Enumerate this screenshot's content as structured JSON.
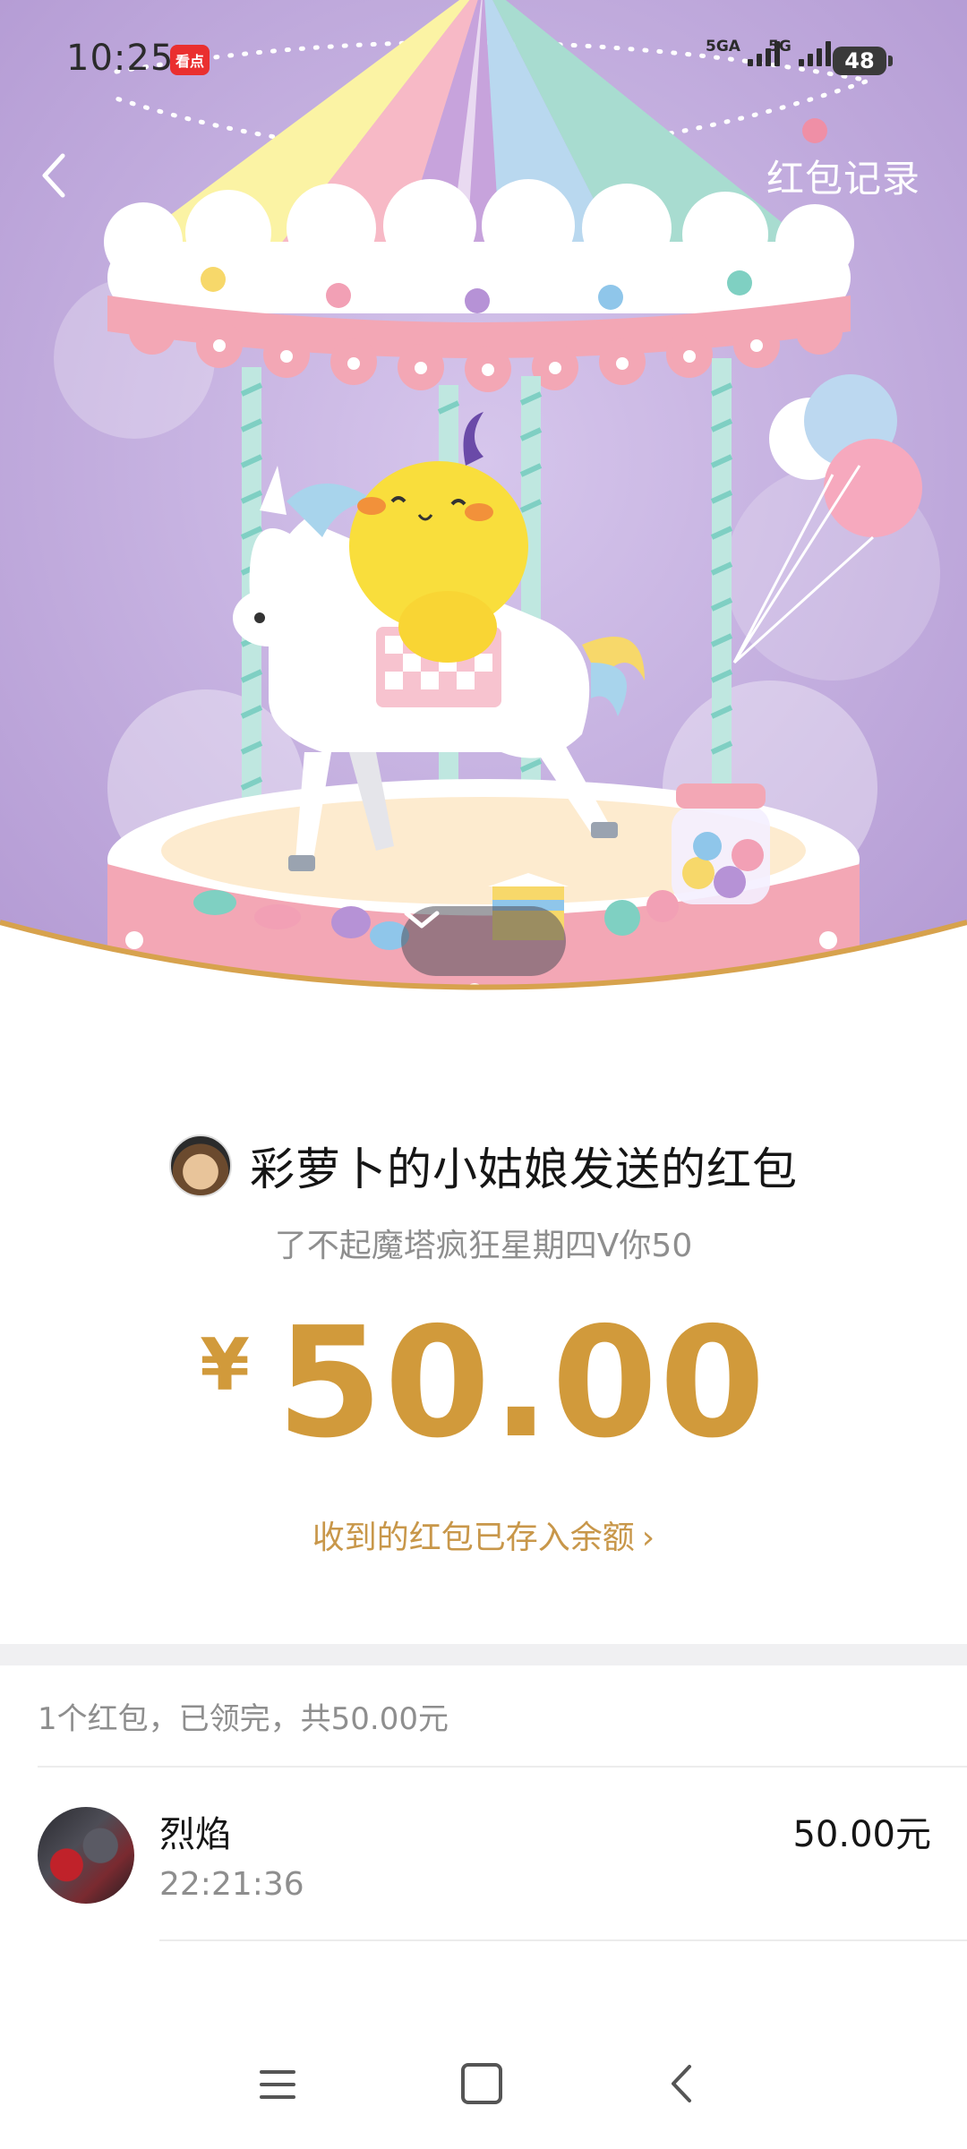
{
  "status_bar": {
    "time": "10:25",
    "news_app_icon": "看点",
    "signal_1_label": "5GA",
    "signal_2_label": "5G",
    "battery": "48"
  },
  "header": {
    "back_icon": "chevron-left-icon",
    "records_link": "红包记录"
  },
  "hero": {
    "expand_icon": "chevron-down-icon"
  },
  "packet": {
    "sender_title": "彩萝卜的小姑娘发送的红包",
    "greeting": "了不起魔塔疯狂星期四V你50",
    "currency_symbol": "¥",
    "amount": "50.00",
    "deposit_link": "收到的红包已存入余额",
    "deposit_chevron": "›"
  },
  "claims": {
    "summary": "1个红包，已领完，共50.00元",
    "items": [
      {
        "name": "烈焰",
        "time": "22:21:36",
        "amount": "50.00元"
      }
    ]
  },
  "colors": {
    "gold": "#d19a3b",
    "hero_bg": "#bba4d8",
    "canopy_pink": "#f3a7b5"
  },
  "nav": {
    "menu_icon": "menu-icon",
    "home_icon": "home-icon",
    "back_icon": "back-icon"
  }
}
